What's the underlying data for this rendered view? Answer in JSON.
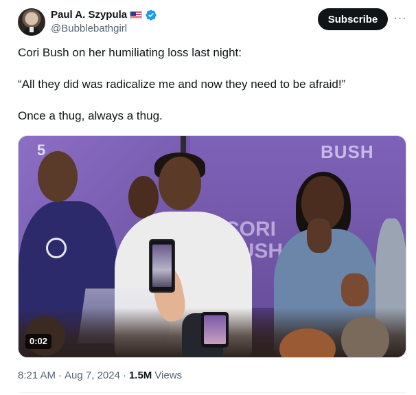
{
  "author": {
    "name": "Paul A. Szypula",
    "handle": "@Bubblebathgirl",
    "flag_icon": "us-flag",
    "verified_icon": "verified-badge",
    "verified_color": "#1d9bf0"
  },
  "header": {
    "subscribe_label": "Subscribe",
    "more_label": "···"
  },
  "tweet": {
    "paragraphs": [
      "Cori Bush on her humiliating loss last night:",
      "“All they did was radicalize me and now they need to be afraid!”",
      "Once a thug, always a thug."
    ]
  },
  "media": {
    "type": "video",
    "duration": "0:02",
    "signage": {
      "bush": "BUSH",
      "cori": "CORI",
      "cori_bush": "BUSH"
    },
    "tv_logo": "5"
  },
  "meta": {
    "time": "8:21 AM",
    "separator": "·",
    "date": "Aug 7, 2024",
    "views_count": "1.5M",
    "views_label": "Views"
  },
  "colors": {
    "text_primary": "#0f1419",
    "text_secondary": "#536471",
    "subscribe_bg": "#0f1419"
  }
}
